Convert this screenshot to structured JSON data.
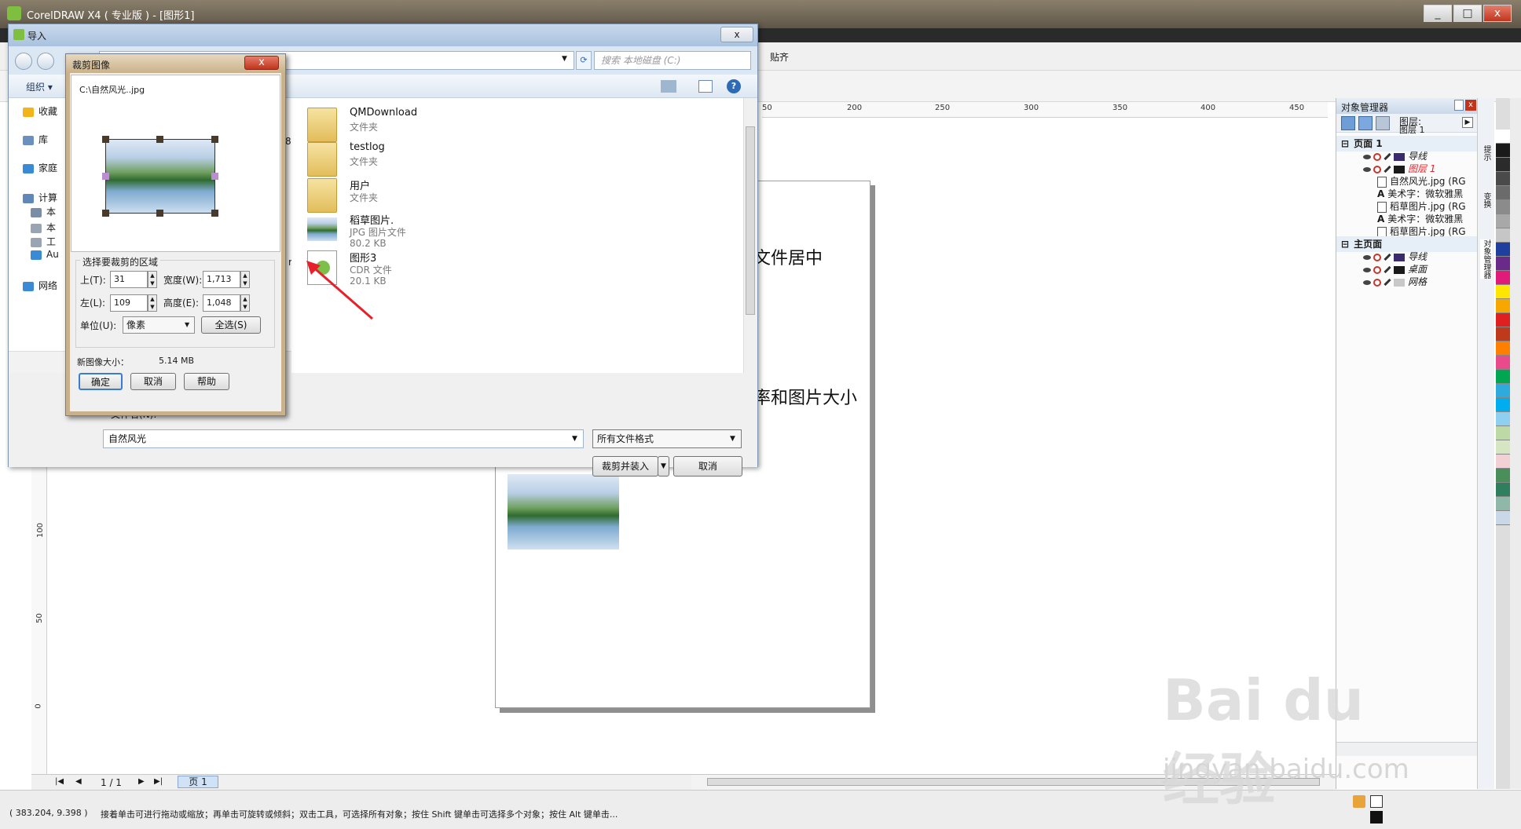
{
  "app": {
    "title": "CorelDRAW X4 ( 专业版 ) - [图形1]",
    "snap_label": "贴齐",
    "window_buttons": [
      "_",
      "□",
      "x"
    ]
  },
  "rulers": {
    "h_ticks": [
      "50",
      "200",
      "250",
      "300",
      "350",
      "400",
      "450"
    ],
    "v_ticks": [
      "100",
      "50",
      "0"
    ]
  },
  "page": {
    "text_line1": "文件居中",
    "text_line2": "率和图片大小"
  },
  "page_nav": {
    "counter": "1 / 1",
    "tab": "页 1"
  },
  "status": {
    "coords": "( 383.204, 9.398 )",
    "hint": "接着单击可进行拖动或缩放；再单击可旋转或倾斜；双击工具，可选择所有对象；按住 Shift 键单击可选择多个对象；按住 Alt 键单击..."
  },
  "docker": {
    "title": "对象管理器",
    "layer_label": "图层:",
    "layer_value": "图层 1",
    "rows": [
      {
        "kind": "section",
        "label": "页面 1"
      },
      {
        "kind": "layer",
        "label": "导线",
        "color": "#3a2a6e"
      },
      {
        "kind": "layer",
        "label": "图层 1",
        "color": "#1a1a1a",
        "active": true
      },
      {
        "kind": "object",
        "label": "自然风光.jpg (RG",
        "icon": "bitmap"
      },
      {
        "kind": "object",
        "label": "美术字：微软雅黑",
        "icon": "text"
      },
      {
        "kind": "object",
        "label": "稻草图片.jpg (RG",
        "icon": "bitmap"
      },
      {
        "kind": "object",
        "label": "美术字：微软雅黑",
        "icon": "text"
      },
      {
        "kind": "object",
        "label": "稻草图片.jpg (RG",
        "icon": "bitmap"
      },
      {
        "kind": "section",
        "label": "主页面"
      },
      {
        "kind": "layer",
        "label": "导线",
        "color": "#3a2a6e"
      },
      {
        "kind": "layer",
        "label": "桌面",
        "color": "#1a1a1a"
      },
      {
        "kind": "layer",
        "label": "网格",
        "color": "#c8c8c8"
      }
    ],
    "side_tabs": [
      "提示",
      "变换",
      "对象管理器"
    ]
  },
  "palette": [
    "#ffffff",
    "#1a1a1a",
    "#2b2b2b",
    "#4a4a4a",
    "#6b6b6b",
    "#8b8b8b",
    "#a8a8a8",
    "#c6c6c6",
    "#1f3f9f",
    "#6a2a8a",
    "#e11b7a",
    "#ffe600",
    "#f6a700",
    "#e02020",
    "#bf3a1a",
    "#ff7f00",
    "#e84a8a",
    "#00a651",
    "#2eaadc",
    "#00aeef",
    "#8fd0f0",
    "#bcd9a6",
    "#d6e6c2",
    "#f2d0d6",
    "#4a8f5a",
    "#2f7f5f",
    "#8fb8a8",
    "#c9d7e8"
  ],
  "import_dialog": {
    "title": "导入",
    "search_placeholder": "搜索 本地磁盘 (C:)",
    "organize": "组织",
    "nav": [
      {
        "label": "收藏",
        "color": "#f3b31b"
      },
      {
        "label": "库",
        "color": "#6b8fbf"
      },
      {
        "label": "家庭",
        "color": "#3a8ad6"
      },
      {
        "label": "计算",
        "color": "#5f87b7"
      },
      {
        "label": "本",
        "color": "#7a8da5"
      },
      {
        "label": "本",
        "color": "#9aa5b3"
      },
      {
        "label": "工",
        "color": "#9aa5b3"
      },
      {
        "label": "Au",
        "color": "#3a8ad6"
      },
      {
        "label": "网络",
        "color": "#3a8ad6"
      }
    ],
    "left_partial_items": [
      "86)",
      "rd"
    ],
    "files": [
      {
        "name": "QMDownload",
        "type": "文件夹",
        "size": "",
        "kind": "folder"
      },
      {
        "name": "testlog",
        "type": "文件夹",
        "size": "",
        "kind": "folder"
      },
      {
        "name": "用户",
        "type": "文件夹",
        "size": "",
        "kind": "folder"
      },
      {
        "name": "稻草图片.",
        "type": "JPG 图片文件",
        "size": "80.2 KB",
        "kind": "image"
      },
      {
        "name": "图形3",
        "type": "CDR 文件",
        "size": "20.1 KB",
        "kind": "cdr"
      }
    ],
    "filename_label": "文件名(N):",
    "filename_value": "自然风光",
    "format": "所有文件格式",
    "import_button": "裁剪并装入",
    "cancel_button": "取消"
  },
  "crop_dialog": {
    "title": "裁剪图像",
    "path": "C:\\自然风光..jpg",
    "group_label": "选择要裁剪的区域",
    "top_label": "上(T):",
    "top_value": "31",
    "width_label": "宽度(W):",
    "width_value": "1,713",
    "left_label": "左(L):",
    "left_value": "109",
    "height_label": "高度(E):",
    "height_value": "1,048",
    "unit_label": "单位(U):",
    "unit_value": "像素",
    "select_all": "全选(S)",
    "new_size_label": "新图像大小：",
    "new_size_value": "5.14 MB",
    "ok": "确定",
    "cancel": "取消",
    "help": "帮助"
  },
  "watermark": {
    "main": "Bai du 经验",
    "sub": "jingyan.baidu.com"
  }
}
